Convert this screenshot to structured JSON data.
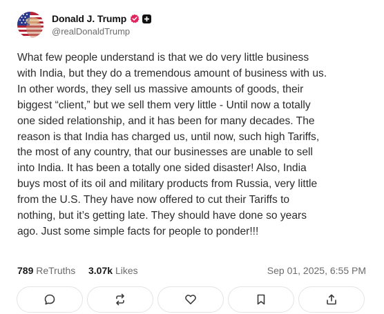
{
  "post": {
    "author": {
      "display_name": "Donald J. Trump",
      "handle": "@realDonaldTrump",
      "avatar_icon": "avatar-american-flag",
      "verified_icon": "verified-badge-icon",
      "verified_color": "#e0245e",
      "extra_badge_icon": "plus-badge-icon"
    },
    "text": "What few people understand is that we do very little business\nwith India, but they do a tremendous amount of business with us.\nIn other words, they sell us massive amounts of goods, their\nbiggest “client,” but we sell them very little - Until now a totally\none sided relationship, and it has been for many decades. The\nreason is that India has charged us, until now, such high Tariffs,\nthe most of any country, that our businesses are unable to sell\ninto India. It has been a totally one sided disaster! Also, India\nbuys most of its oil and military products from Russia, very little\nfrom the U.S. They have now offered to cut their Tariffs to\nnothing, but it’s getting late. They should have done so years\nago. Just some simple facts for people to ponder!!!",
    "stats": {
      "retruths_count": "789",
      "retruths_label": "ReTruths",
      "likes_count": "3.07k",
      "likes_label": "Likes"
    },
    "timestamp": "Sep 01, 2025, 6:55 PM",
    "actions": [
      {
        "icon": "reply-icon"
      },
      {
        "icon": "retruth-icon"
      },
      {
        "icon": "heart-icon"
      },
      {
        "icon": "bookmark-icon"
      },
      {
        "icon": "share-icon"
      }
    ]
  }
}
